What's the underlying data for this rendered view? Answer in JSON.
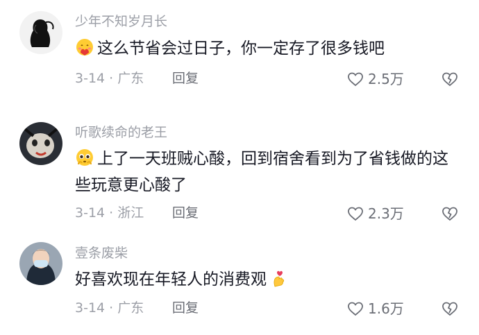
{
  "comments": [
    {
      "username": "少年不知岁月长",
      "text": "这么节省会过日子，你一定存了很多钱吧",
      "lead_emoji": "hug-face-emoji",
      "date": "3-14",
      "location": "广东",
      "meta": "3-14 · 广东",
      "reply_label": "回复",
      "like_count": "2.5万"
    },
    {
      "username": "听歌续命的老王",
      "text": "上了一天班贼心酸，回到宿舍看到为了省钱做的这些玩意更心酸了",
      "lead_emoji": "pleading-face-emoji",
      "date": "3-14",
      "location": "浙江",
      "meta": "3-14 · 浙江",
      "reply_label": "回复",
      "like_count": "2.3万"
    },
    {
      "username": "壹条废柴",
      "text": "好喜欢现在年轻人的消费观",
      "tail_emoji": "finger-heart-emoji",
      "date": "3-14",
      "location": "广东",
      "meta": "3-14 · 广东",
      "reply_label": "回复",
      "like_count": "1.6万"
    }
  ],
  "icons": {
    "like": "heart-outline-icon",
    "dislike": "broken-heart-icon"
  },
  "colors": {
    "username": "#9b9ea6",
    "text": "#161823",
    "meta": "#9b9ea6",
    "action": "#6a6d75"
  }
}
